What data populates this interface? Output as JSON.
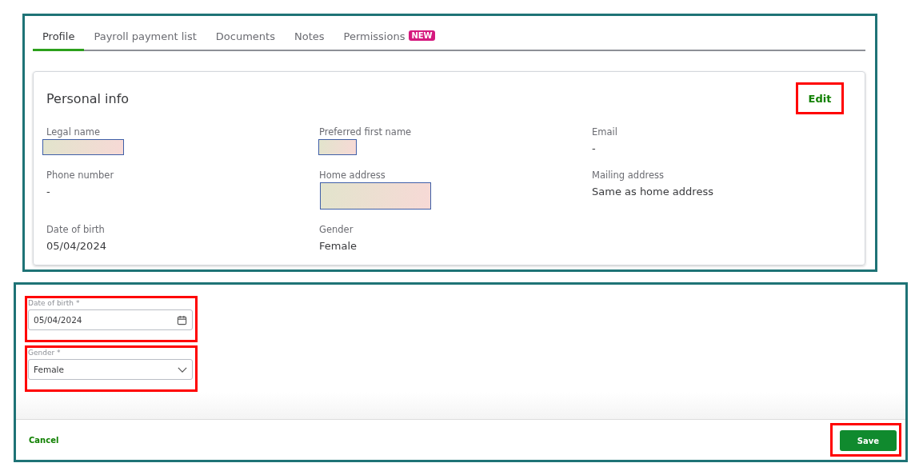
{
  "tabs": [
    {
      "label": "Profile",
      "selected": true
    },
    {
      "label": "Payroll payment list",
      "selected": false
    },
    {
      "label": "Documents",
      "selected": false
    },
    {
      "label": "Notes",
      "selected": false
    },
    {
      "label": "Permissions",
      "selected": false,
      "badge": "NEW"
    }
  ],
  "personal_info": {
    "title": "Personal info",
    "edit_button": {
      "label": "Edit",
      "highlighted": true
    },
    "fields": [
      {
        "label": "Legal name",
        "kind": "redacted"
      },
      {
        "label": "Preferred first name",
        "kind": "redacted"
      },
      {
        "label": "Email",
        "kind": "text",
        "value": "-"
      },
      {
        "label": "Phone number",
        "kind": "text",
        "value": "-"
      },
      {
        "label": "Home address",
        "kind": "redacted"
      },
      {
        "label": "Mailing address",
        "kind": "text",
        "value": "Same as home address"
      },
      {
        "label": "Date of birth",
        "kind": "text",
        "value": "05/04/2024"
      },
      {
        "label": "Gender",
        "kind": "text",
        "value": "Female"
      }
    ]
  },
  "edit_form": {
    "fields": [
      {
        "label": "Date of birth *",
        "kind": "date",
        "value": "05/04/2024",
        "highlighted": true
      },
      {
        "label": "Gender *",
        "kind": "select",
        "value": "Female",
        "highlighted": true
      }
    ],
    "cancel": "Cancel",
    "save": {
      "label": "Save",
      "highlighted": true
    }
  }
}
